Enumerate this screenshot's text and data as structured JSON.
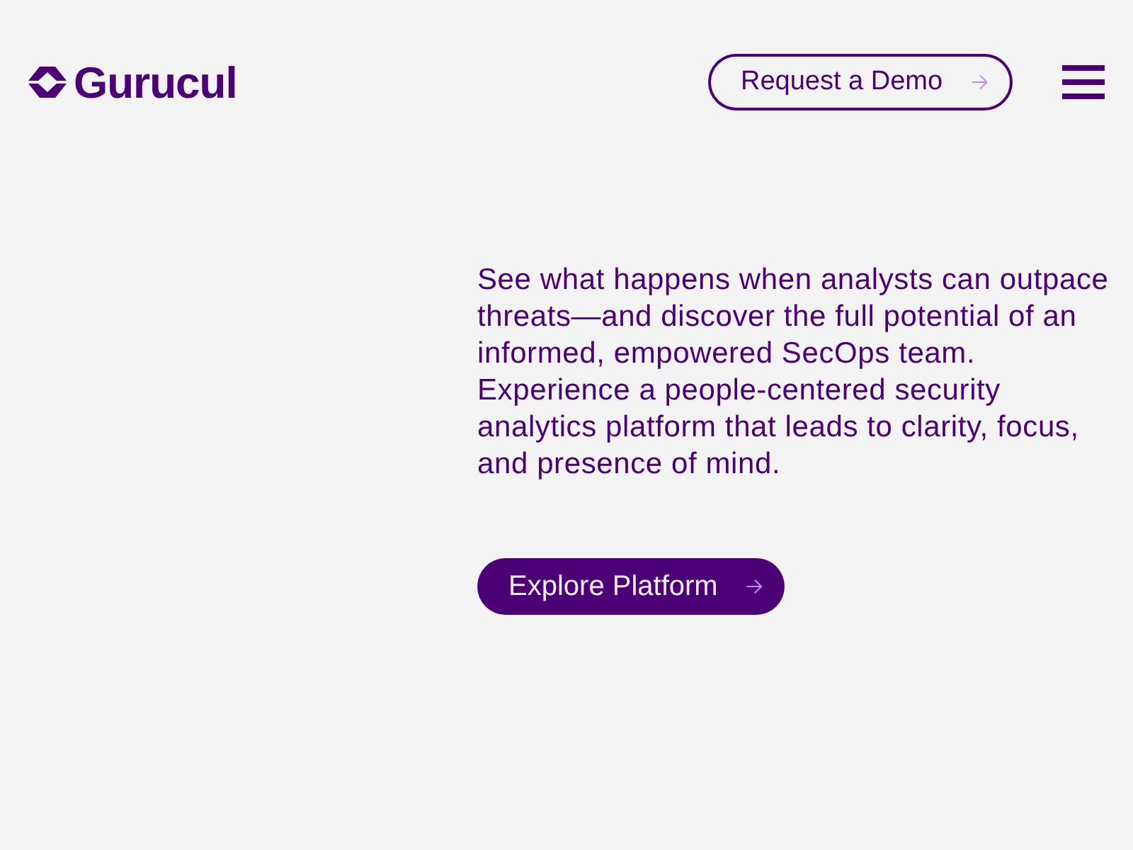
{
  "header": {
    "logo": "Gurucul",
    "demo_button": "Request a Demo"
  },
  "hero": {
    "paragraphs": [
      "See what happens when analysts can outpace threats—and discover the full potential of an informed, empowered SecOps team.",
      "Experience a people-centered security analytics platform that leads to clarity, focus, and presence of mind."
    ],
    "cta_button": "Explore Platform"
  }
}
